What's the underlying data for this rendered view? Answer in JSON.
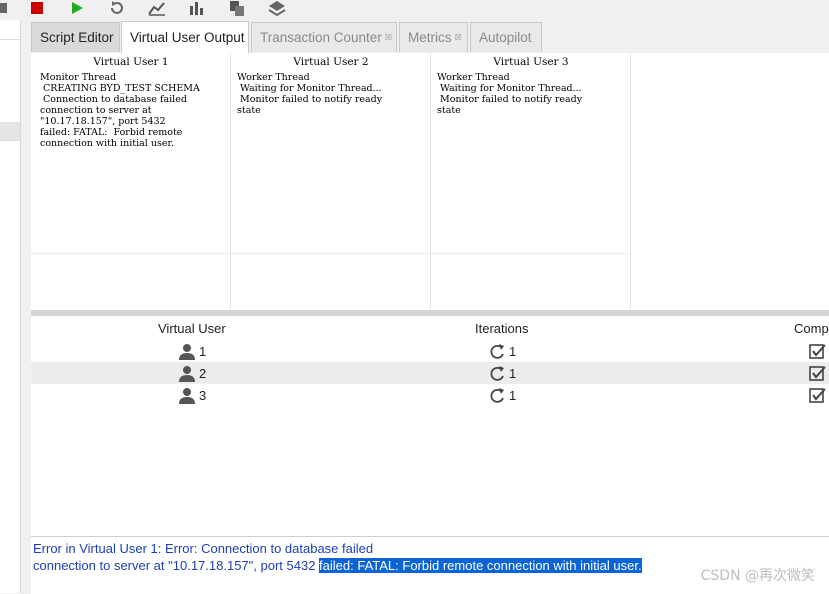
{
  "tabs": [
    {
      "label": "Script Editor"
    },
    {
      "label": "Virtual User Output"
    },
    {
      "label": "Transaction Counter"
    },
    {
      "label": "Metrics"
    },
    {
      "label": "Autopilot"
    }
  ],
  "tab_close_glyph": "☒",
  "virtual_users_output": [
    {
      "title": "Virtual User 1",
      "text": "Monitor Thread\n CREATING BYD_TEST SCHEMA\n Connection to database failed\nconnection to server at\n\"10.17.18.157\", port 5432\nfailed: FATAL:  Forbid remote\nconnection with initial user."
    },
    {
      "title": "Virtual User 2",
      "text": "Worker Thread\n Waiting for Monitor Thread...\n Monitor failed to notify ready\nstate"
    },
    {
      "title": "Virtual User 3",
      "text": "Worker Thread\n Waiting for Monitor Thread...\n Monitor failed to notify ready\nstate"
    }
  ],
  "table": {
    "headers": {
      "virtual_user": "Virtual User",
      "iterations": "Iterations",
      "complete": "Comp"
    },
    "rows": [
      {
        "user": "1",
        "iterations": "1"
      },
      {
        "user": "2",
        "iterations": "1"
      },
      {
        "user": "3",
        "iterations": "1"
      }
    ]
  },
  "console": {
    "line1": "Error in Virtual User 1: Error: Connection to database failed",
    "line2_plain": "connection to server at \"10.17.18.157\", port 5432 ",
    "line2_selected": "failed: FATAL:  Forbid remote connection with initial user."
  },
  "watermark": "CSDN @再次微笑",
  "icons": [
    "stop-icon",
    "play-icon",
    "refresh-icon",
    "line-chart-icon",
    "bar-chart-icon",
    "copy-icon",
    "layers-icon",
    "user-icon",
    "reload-icon",
    "checkbox-icon"
  ],
  "colors": {
    "stop": "#cc0000",
    "play": "#22aa22",
    "console_text": "#1c3fb8",
    "selection": "#0a64d6"
  }
}
